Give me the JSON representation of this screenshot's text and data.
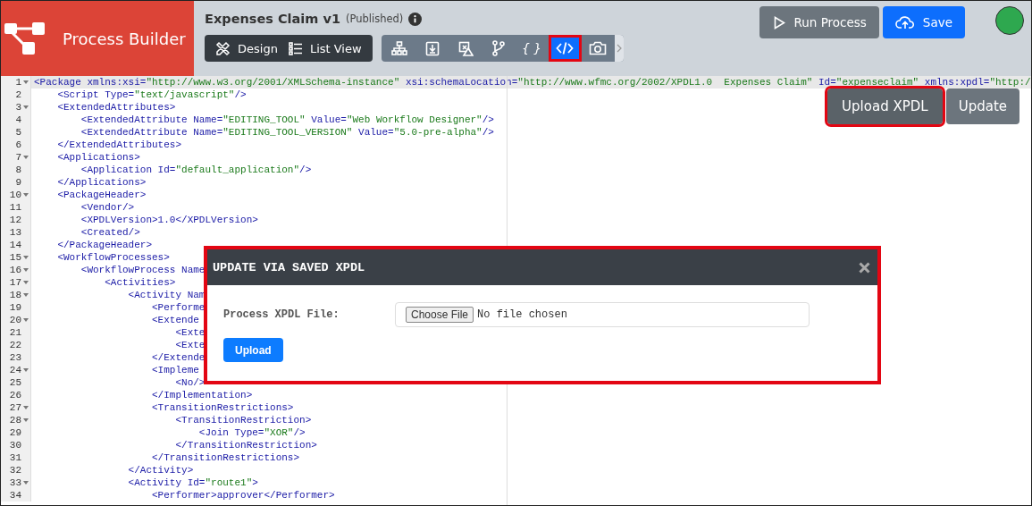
{
  "brand": {
    "title": "Process Builder"
  },
  "header": {
    "title": "Expenses Claim v1",
    "status": "(Published)"
  },
  "view_tabs": [
    {
      "label": "Design"
    },
    {
      "label": "List View"
    }
  ],
  "tools": [
    {
      "selected": false,
      "highlighted": false
    },
    {
      "selected": false,
      "highlighted": false
    },
    {
      "selected": false,
      "highlighted": false
    },
    {
      "selected": false,
      "highlighted": false
    },
    {
      "label": "{ }",
      "selected": false,
      "highlighted": false
    },
    {
      "selected": true,
      "highlighted": true
    },
    {
      "selected": false,
      "highlighted": false
    }
  ],
  "actions": [
    {
      "label": "Run Process",
      "kind": "run"
    },
    {
      "label": "Save",
      "kind": "save"
    }
  ],
  "editor": {
    "buttons": [
      {
        "label": "Upload XPDL",
        "highlighted": true
      },
      {
        "label": "Update",
        "highlighted": false
      }
    ],
    "lines": [
      {
        "number": "1",
        "text": "<Package xmlns:xsi=\"http://www.w3.org/2001/XMLSchema-instance\" xsi:schemaLocation=\"http://www.wfmc.org/2002/XPDL1.0  Expenses Claim\" Id=\"expenseclaim\" xmlns:xpdl=\"http:/",
        "foldable": true,
        "active": true
      },
      {
        "number": "2",
        "text": "    <Script Type=\"text/javascript\"/>",
        "foldable": false,
        "active": false
      },
      {
        "number": "3",
        "text": "    <ExtendedAttributes>",
        "foldable": true,
        "active": false
      },
      {
        "number": "4",
        "text": "        <ExtendedAttribute Name=\"EDITING_TOOL\" Value=\"Web Workflow Designer\"/>",
        "foldable": false,
        "active": false
      },
      {
        "number": "5",
        "text": "        <ExtendedAttribute Name=\"EDITING_TOOL_VERSION\" Value=\"5.0-pre-alpha\"/>",
        "foldable": false,
        "active": false
      },
      {
        "number": "6",
        "text": "    </ExtendedAttributes>",
        "foldable": false,
        "active": false
      },
      {
        "number": "7",
        "text": "    <Applications>",
        "foldable": true,
        "active": false
      },
      {
        "number": "8",
        "text": "        <Application Id=\"default_application\"/>",
        "foldable": false,
        "active": false
      },
      {
        "number": "9",
        "text": "    </Applications>",
        "foldable": false,
        "active": false
      },
      {
        "number": "10",
        "text": "    <PackageHeader>",
        "foldable": true,
        "active": false
      },
      {
        "number": "11",
        "text": "        <Vendor/>",
        "foldable": false,
        "active": false
      },
      {
        "number": "12",
        "text": "        <XPDLVersion>1.0</XPDLVersion>",
        "foldable": false,
        "active": false
      },
      {
        "number": "13",
        "text": "        <Created/>",
        "foldable": false,
        "active": false
      },
      {
        "number": "14",
        "text": "    </PackageHeader>",
        "foldable": false,
        "active": false
      },
      {
        "number": "15",
        "text": "    <WorkflowProcesses>",
        "foldable": true,
        "active": false
      },
      {
        "number": "16",
        "text": "        <WorkflowProcess Name",
        "foldable": true,
        "active": false
      },
      {
        "number": "17",
        "text": "            <Activities>",
        "foldable": true,
        "active": false
      },
      {
        "number": "18",
        "text": "                <Activity Nam",
        "foldable": true,
        "active": false
      },
      {
        "number": "19",
        "text": "                    <Performe",
        "foldable": false,
        "active": false
      },
      {
        "number": "20",
        "text": "                    <Extende",
        "foldable": true,
        "active": false
      },
      {
        "number": "21",
        "text": "                        <Exte",
        "foldable": false,
        "active": false
      },
      {
        "number": "22",
        "text": "                        <Exte",
        "foldable": false,
        "active": false
      },
      {
        "number": "23",
        "text": "                    </Extende",
        "foldable": false,
        "active": false
      },
      {
        "number": "24",
        "text": "                    <Impleme",
        "foldable": true,
        "active": false
      },
      {
        "number": "25",
        "text": "                        <No/>",
        "foldable": false,
        "active": false
      },
      {
        "number": "26",
        "text": "                    </Implementation>",
        "foldable": false,
        "active": false
      },
      {
        "number": "27",
        "text": "                    <TransitionRestrictions>",
        "foldable": true,
        "active": false
      },
      {
        "number": "28",
        "text": "                        <TransitionRestriction>",
        "foldable": true,
        "active": false
      },
      {
        "number": "29",
        "text": "                            <Join Type=\"XOR\"/>",
        "foldable": false,
        "active": false
      },
      {
        "number": "30",
        "text": "                        </TransitionRestriction>",
        "foldable": false,
        "active": false
      },
      {
        "number": "31",
        "text": "                    </TransitionRestrictions>",
        "foldable": false,
        "active": false
      },
      {
        "number": "32",
        "text": "                </Activity>",
        "foldable": false,
        "active": false
      },
      {
        "number": "33",
        "text": "                <Activity Id=\"route1\">",
        "foldable": true,
        "active": false
      },
      {
        "number": "34",
        "text": "                    <Performer>approver</Performer>",
        "foldable": false,
        "active": false
      }
    ]
  },
  "dialog": {
    "title": "UPDATE VIA SAVED XPDL",
    "highlighted": true,
    "field_label": "Process XPDL File:",
    "file_button": "Choose File",
    "file_status": "No file chosen",
    "submit": "Upload"
  }
}
